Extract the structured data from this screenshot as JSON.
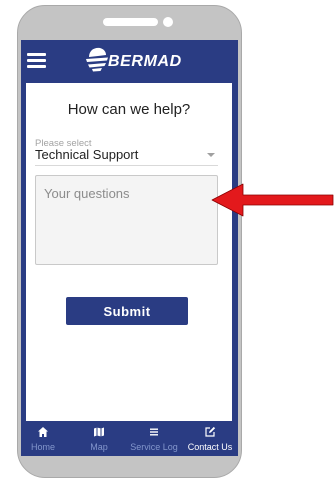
{
  "colors": {
    "brand_navy": "#2a3c83",
    "annotation_red": "#e3191c",
    "phone_frame": "#c4c4c4",
    "nav_inactive_label": "#8396cc",
    "nav_active_label": "#ffffff"
  },
  "phone": {
    "speaker_icon": "speaker-slot-icon",
    "camera_icon": "front-camera-icon"
  },
  "header": {
    "menu_icon": "hamburger-menu-icon",
    "logo_icon": "bermad-logo-icon",
    "logo_text": "BERMAD"
  },
  "contact_form": {
    "title": "How can we help?",
    "category_select": {
      "label": "Please select",
      "value": "Technical Support",
      "icon": "caret-down-icon"
    },
    "questions_field": {
      "placeholder": "Your questions"
    },
    "submit_label": "Submit"
  },
  "annotation": {
    "arrow_icon": "red-arrow-left-icon"
  },
  "bottom_nav": {
    "items": [
      {
        "label": "Home",
        "icon": "home-icon",
        "active": false
      },
      {
        "label": "Map",
        "icon": "map-icon",
        "active": false
      },
      {
        "label": "Service Log",
        "icon": "list-icon",
        "active": false
      },
      {
        "label": "Contact Us",
        "icon": "edit-icon",
        "active": true
      }
    ]
  }
}
